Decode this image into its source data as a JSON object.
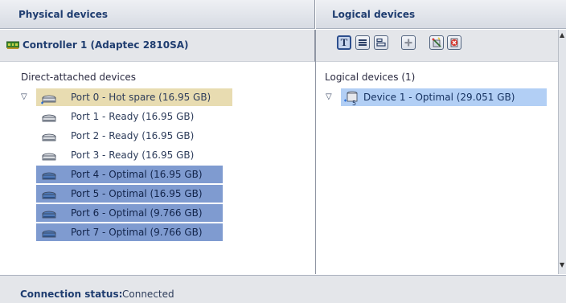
{
  "physical": {
    "header": "Physical devices",
    "controller_label": "Controller 1 (Adaptec 2810SA)",
    "section_label": "Direct-attached devices",
    "ports": [
      {
        "label": "Port 0 - Hot spare (16.95 GB)",
        "state": "hot-spare"
      },
      {
        "label": "Port 1 - Ready (16.95 GB)",
        "state": "ready"
      },
      {
        "label": "Port 2 - Ready (16.95 GB)",
        "state": "ready"
      },
      {
        "label": "Port 3 - Ready (16.95 GB)",
        "state": "ready"
      },
      {
        "label": "Port 4 - Optimal (16.95 GB)",
        "state": "optimal"
      },
      {
        "label": "Port 5 - Optimal (16.95 GB)",
        "state": "optimal"
      },
      {
        "label": "Port 6 - Optimal (9.766 GB)",
        "state": "optimal"
      },
      {
        "label": "Port 7 - Optimal (9.766 GB)",
        "state": "optimal"
      }
    ]
  },
  "logical": {
    "header": "Logical devices",
    "section_label": "Logical devices (1)",
    "devices": [
      {
        "label": "Device 1 - Optimal (29.051 GB)",
        "raid_level": "5"
      }
    ],
    "toolbar_icons": [
      "text-view-icon",
      "list-view-icon",
      "detail-view-icon",
      "add-icon",
      "create-logical-device-icon",
      "delete-logical-device-icon"
    ]
  },
  "status": {
    "key": "Connection status:",
    "value": "Connected"
  },
  "colors": {
    "hot_spare_highlight": "#e8dcb1",
    "optimal_highlight": "#7f9bd0",
    "logical_highlight": "#b2cff5",
    "header_text": "#1f3d70"
  }
}
